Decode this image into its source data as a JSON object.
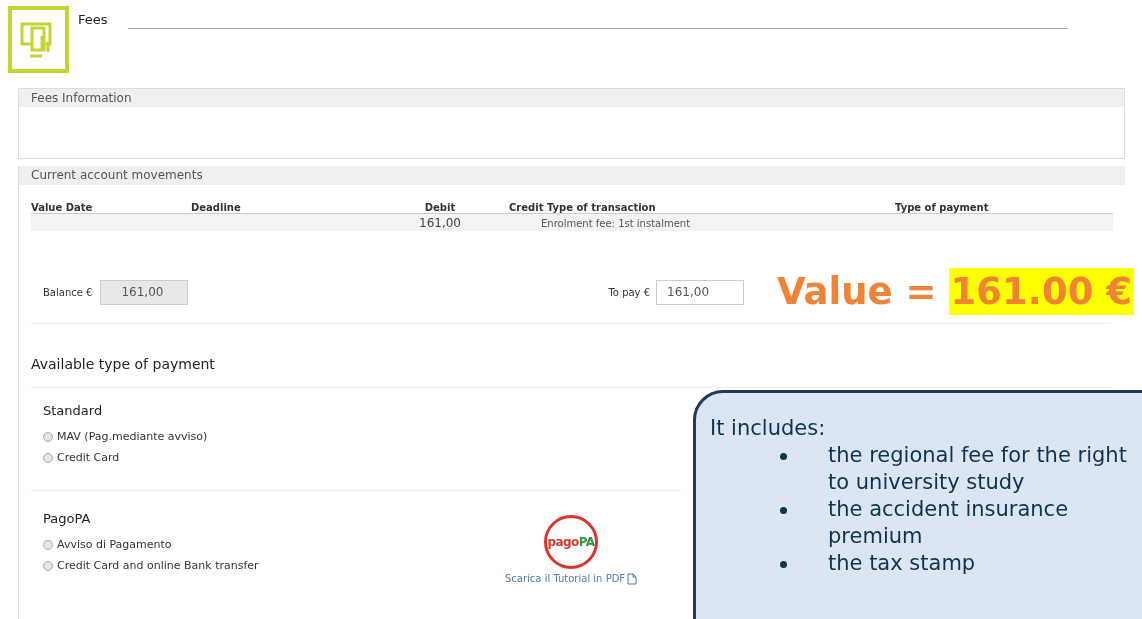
{
  "header": {
    "title": "Fees"
  },
  "fees_information": {
    "title": "Fees Information"
  },
  "movements": {
    "title": "Current account movements",
    "columns": [
      "Value Date",
      "Deadline",
      "Debit",
      "Credit Type of transaction",
      "Type of payment"
    ],
    "rows": [
      {
        "debit": "161,00",
        "type_of_transaction": "Enrolment fee: 1st instalment"
      }
    ]
  },
  "balance": {
    "label": "Balance €",
    "value": "161,00"
  },
  "to_pay": {
    "label": "To pay €",
    "value": "161,00"
  },
  "payment": {
    "title": "Available type of payment",
    "groups": [
      {
        "title": "Standard",
        "options": [
          {
            "label": "MAV (Pag.mediante avviso)",
            "selected": false
          },
          {
            "label": "Credit Card",
            "selected": false
          }
        ]
      },
      {
        "title": "PagoPA",
        "options": [
          {
            "label": "Avviso di Pagamento",
            "selected": false
          },
          {
            "label": "Credit Card and online Bank transfer",
            "selected": false
          }
        ]
      }
    ]
  },
  "pagopa": {
    "logo_text": [
      "pago",
      "PA"
    ],
    "tutorial_link": "Scarica il Tutorial in PDF"
  },
  "value_note": {
    "label": "Value =",
    "amount": "161.00 €"
  },
  "callout": {
    "intro": "It includes:",
    "items": [
      "the regional fee for the right to university study",
      "the accident insurance premium",
      "the tax stamp"
    ]
  }
}
